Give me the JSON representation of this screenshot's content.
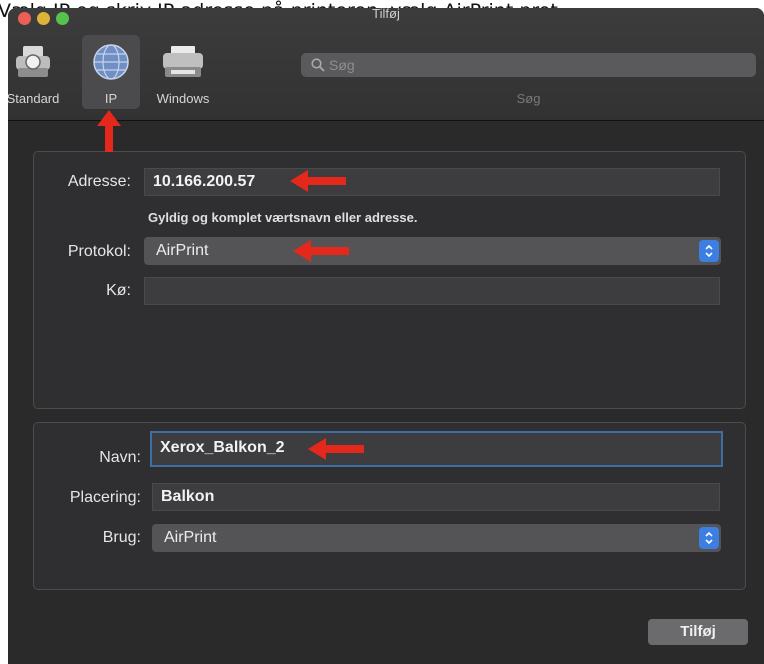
{
  "caption": "Vælg IP og skriv IP-adresse på printeren, vælg AirPrint prot",
  "window": {
    "title": "Tilføj"
  },
  "toolbar": {
    "tabs": [
      {
        "label": "Standard",
        "icon": "default-printer-icon"
      },
      {
        "label": "IP",
        "icon": "globe-icon"
      },
      {
        "label": "Windows",
        "icon": "windows-printer-icon"
      }
    ],
    "search_placeholder": "Søg",
    "search_caption": "Søg"
  },
  "form": {
    "address_label": "Adresse:",
    "address_value": "10.166.200.57",
    "address_hint": "Gyldig og komplet værtsnavn eller adresse.",
    "protocol_label": "Protokol:",
    "protocol_value": "AirPrint",
    "queue_label": "Kø:",
    "queue_value": "",
    "name_label": "Navn:",
    "name_value": "Xerox_Balkon_2",
    "location_label": "Placering:",
    "location_value": "Balkon",
    "use_label": "Brug:",
    "use_value": "AirPrint"
  },
  "buttons": {
    "add_label": "Tilføj"
  },
  "colors": {
    "accent": "#3c7ee2",
    "annotation": "#e5281c"
  }
}
